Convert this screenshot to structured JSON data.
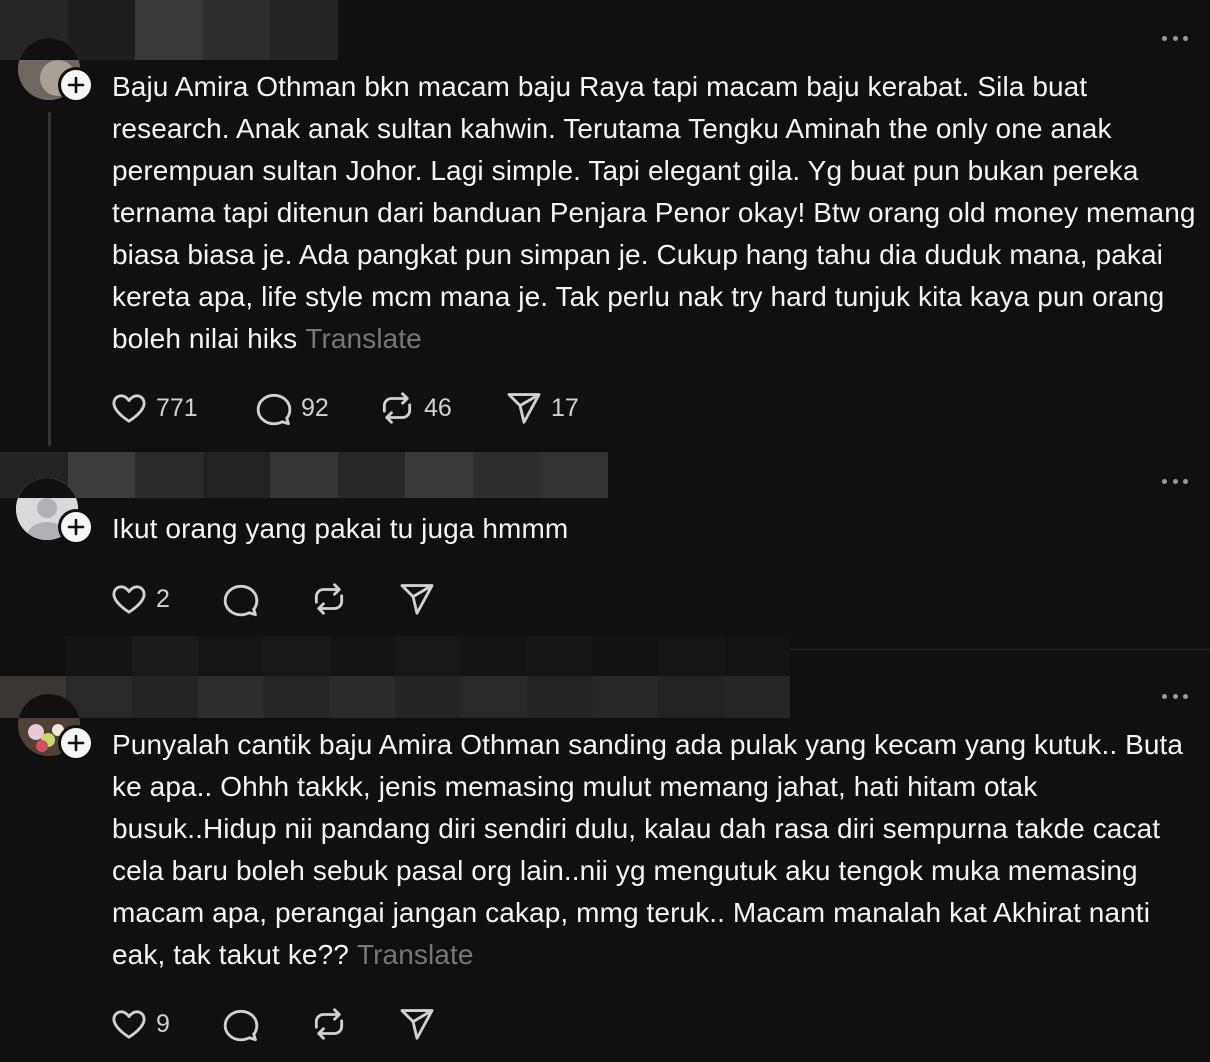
{
  "posts": [
    {
      "text": "Baju Amira Othman bkn macam baju Raya tapi macam baju kerabat. Sila buat research. Anak anak sultan kahwin. Terutama Tengku Aminah the only one anak perempuan sultan Johor. Lagi simple. Tapi elegant gila. Yg buat pun bukan pereka ternama tapi ditenun dari banduan Penjara Penor okay! Btw orang old money memang biasa biasa je. Ada pangkat pun simpan je. Cukup hang tahu dia duduk mana, pakai kereta apa, life style mcm mana je. Tak perlu nak try hard tunjuk kita kaya pun orang boleh nilai hiks",
      "translate_label": "Translate",
      "likes": "771",
      "replies": "92",
      "reposts": "46",
      "shares": "17"
    },
    {
      "text": "Ikut orang yang pakai tu juga hmmm",
      "likes": "2"
    },
    {
      "text": "Punyalah cantik baju Amira Othman sanding ada pulak yang kecam yang kutuk.. Buta ke apa.. Ohhh takkk, jenis memasing mulut memang jahat, hati hitam otak busuk..Hidup nii pandang diri sendiri dulu, kalau dah rasa diri sempurna takde cacat cela baru boleh sebuk pasal org lain..nii yg mengutuk aku tengok muka memasing macam apa, perangai jangan cakap, mmg teruk.. Macam manalah kat Akhirat nanti eak, tak takut ke??",
      "translate_label": "Translate",
      "likes": "9"
    }
  ],
  "icons": {
    "like": "heart-icon",
    "reply": "comment-icon",
    "repost": "repost-icon",
    "share": "send-icon",
    "follow": "plus-icon",
    "menu": "more-dots-icon"
  },
  "colors": {
    "background": "#101010",
    "text": "#f3f5f7",
    "muted": "#777777"
  }
}
